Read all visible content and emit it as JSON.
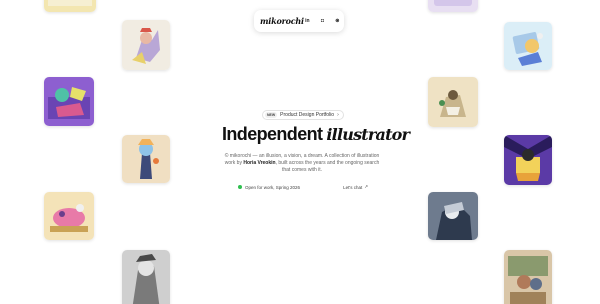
{
  "nav": {
    "logo": "mikorochi",
    "social": [
      {
        "name": "linkedin-icon",
        "glyph": "in"
      },
      {
        "name": "instagram-icon",
        "glyph": "◘"
      },
      {
        "name": "dribbble-icon",
        "glyph": "⊛"
      }
    ]
  },
  "hero": {
    "badge_new": "NEW",
    "badge_label": "Product Design Portfolio",
    "badge_arrow": "›",
    "headline_main": "Independent",
    "headline_script": "illustrator",
    "description_lead": "© mikorochi — an illusion, a vision, a dream. A collection of illustration work by ",
    "description_name": "Horia Vreokin",
    "description_tail": ", built across the years and the ongoing search that comes with it.",
    "status": "Open for work, Spring 2026",
    "chat": "Let's chat",
    "chat_arrow": "↗"
  },
  "gallery": [
    {
      "name": "artwork-tile-1"
    },
    {
      "name": "artwork-tile-2"
    },
    {
      "name": "artwork-tile-3"
    },
    {
      "name": "artwork-tile-4"
    },
    {
      "name": "artwork-tile-5"
    },
    {
      "name": "artwork-tile-6"
    },
    {
      "name": "artwork-tile-7"
    },
    {
      "name": "artwork-tile-8"
    },
    {
      "name": "artwork-tile-9"
    },
    {
      "name": "artwork-tile-10"
    },
    {
      "name": "artwork-tile-11"
    },
    {
      "name": "artwork-tile-12"
    },
    {
      "name": "artwork-tile-13"
    }
  ]
}
